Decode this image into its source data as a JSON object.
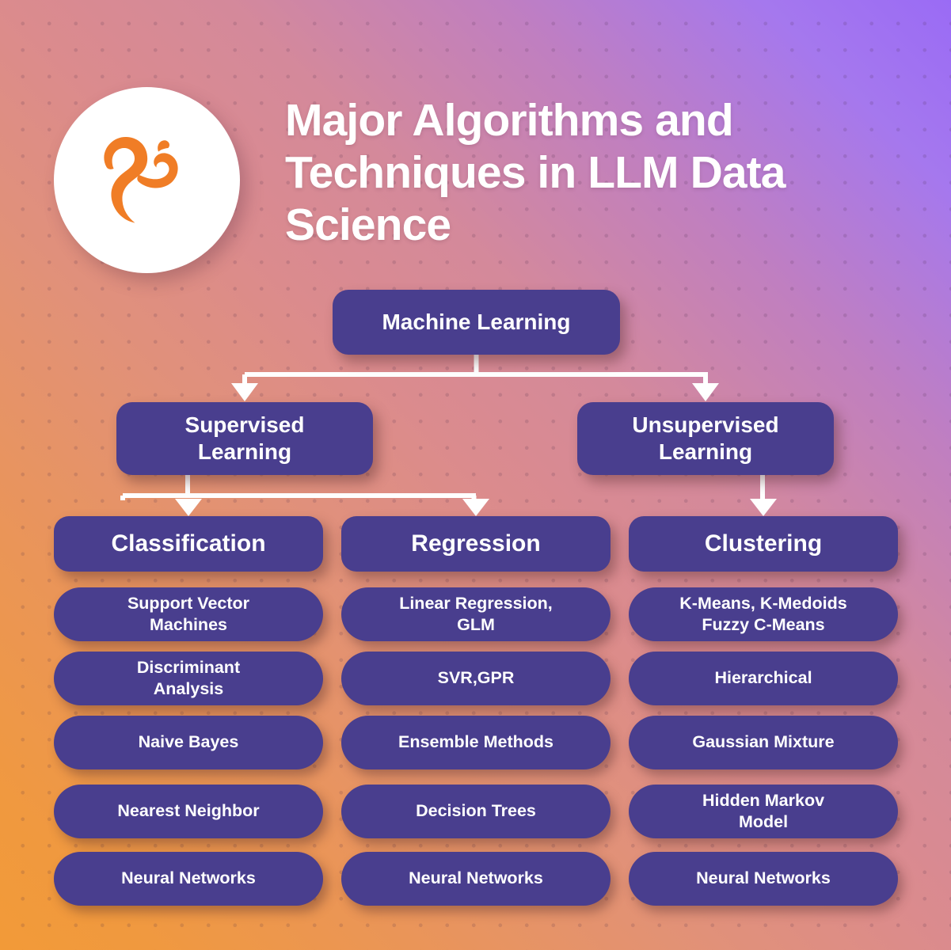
{
  "meta": {
    "logo_icon": "squirrel-logo-icon",
    "logo_color": "#f07d26",
    "node_color": "#493e8e",
    "text_color": "#ffffff",
    "bg_gradient_from": "#9a6bf5",
    "bg_gradient_mid": "#db8b8d",
    "bg_gradient_to": "#f0993f",
    "connector_color": "#ffffff"
  },
  "header": {
    "title": "Major Algorithms\nand Techniques in LLM\nData Science"
  },
  "chart_data": {
    "type": "diagram",
    "diagram_kind": "tree",
    "title": "Major Algorithms and Techniques in LLM Data Science",
    "root": "Machine Learning",
    "nodes": {
      "root": {
        "label": "Machine Learning"
      },
      "level2": [
        {
          "label": "Supervised\nLearning",
          "plain": "Supervised Learning"
        },
        {
          "label": "Unsupervised\nLearning",
          "plain": "Unsupervised Learning"
        }
      ],
      "level3": [
        {
          "label": "Classification",
          "parent": "Supervised Learning"
        },
        {
          "label": "Regression",
          "parent": "Supervised Learning"
        },
        {
          "label": "Clustering",
          "parent": "Unsupervised Learning"
        }
      ]
    },
    "columns": [
      {
        "category": "Classification",
        "items": [
          "Support Vector\nMachines",
          "Discriminant\nAnalysis",
          "Naive Bayes",
          "Nearest Neighbor",
          "Neural Networks"
        ]
      },
      {
        "category": "Regression",
        "items": [
          "Linear Regression,\nGLM",
          "SVR,GPR",
          "Ensemble Methods",
          "Decision Trees",
          "Neural Networks"
        ]
      },
      {
        "category": "Clustering",
        "items": [
          "K-Means, K-Medoids\nFuzzy C-Means",
          "Hierarchical",
          "Gaussian Mixture",
          "Hidden Markov\nModel",
          "Neural Networks"
        ]
      }
    ],
    "edges": [
      {
        "from": "Machine Learning",
        "to": "Supervised Learning"
      },
      {
        "from": "Machine Learning",
        "to": "Unsupervised Learning"
      },
      {
        "from": "Supervised Learning",
        "to": "Classification"
      },
      {
        "from": "Supervised Learning",
        "to": "Regression"
      },
      {
        "from": "Unsupervised Learning",
        "to": "Clustering"
      }
    ]
  }
}
